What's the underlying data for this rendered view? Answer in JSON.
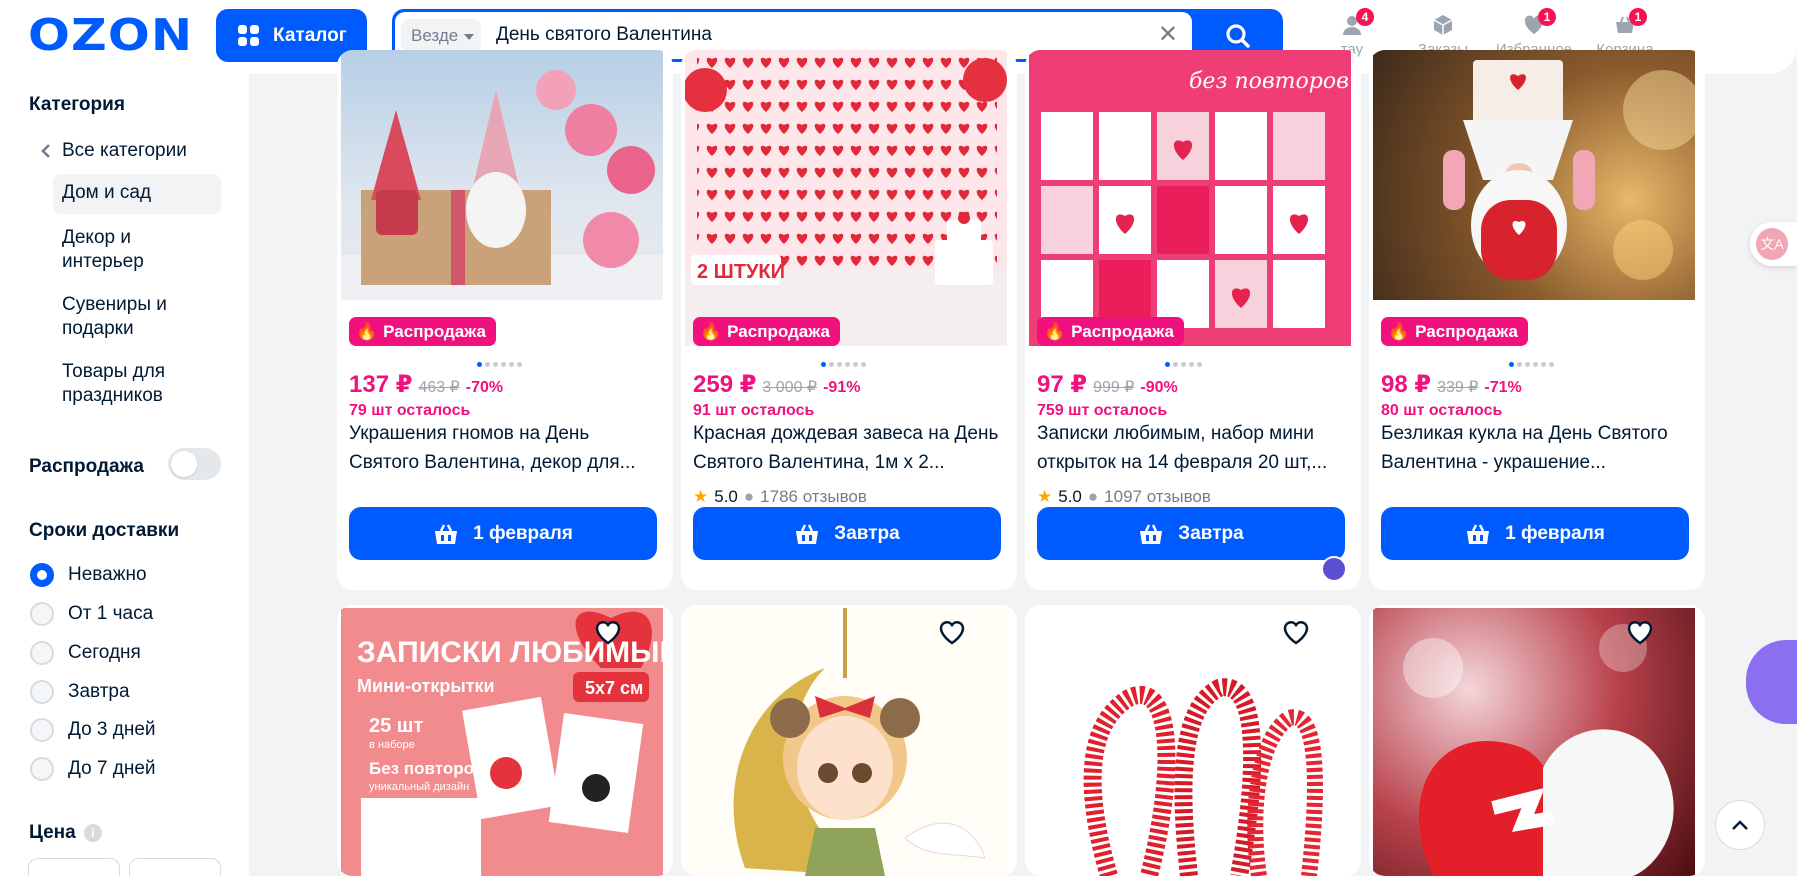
{
  "header": {
    "logo": "OZON",
    "catalog_label": "Каталог",
    "search": {
      "scope": "Везде",
      "query": "День святого Валентина"
    },
    "items": [
      {
        "label": "тау",
        "icon": "user-icon",
        "badge": "4"
      },
      {
        "label": "Заказы",
        "icon": "box-icon",
        "badge": ""
      },
      {
        "label": "Избранное",
        "icon": "heart-icon",
        "badge": "1"
      },
      {
        "label": "Корзина",
        "icon": "cart-icon",
        "badge": "1"
      }
    ]
  },
  "sidebar": {
    "category_title": "Категория",
    "all_categories": "Все категории",
    "active_category": "Дом и сад",
    "subcategories": [
      "Декор и интерьер",
      "Сувениры и подарки",
      "Товары для праздников"
    ],
    "sale_label": "Распродажа",
    "sale_on": false,
    "delivery_title": "Сроки доставки",
    "delivery_options": [
      "Неважно",
      "От 1 часа",
      "Сегодня",
      "Завтра",
      "До 3 дней",
      "До 7 дней"
    ],
    "delivery_selected": "Неважно",
    "price_title": "Цена",
    "price_info_icon": "info-icon"
  },
  "products": [
    {
      "sale_tag": "Распродажа",
      "price": "137 ₽",
      "old_price": "463 ₽",
      "discount": "-70%",
      "stock": "79 шт осталось",
      "title": "Украшения гномов на День Святого Валентина, декор для...",
      "rating": "",
      "reviews": "",
      "button": "1 февраля"
    },
    {
      "sale_tag": "Распродажа",
      "price": "259 ₽",
      "old_price": "3 000 ₽",
      "discount": "-91%",
      "stock": "91 шт осталось",
      "title": "Красная дождевая завеса на День Святого Валентина, 1м х 2...",
      "rating": "5.0",
      "reviews": "1786 отзывов",
      "button": "Завтра",
      "image_badge": "2 ШТУКИ"
    },
    {
      "sale_tag": "Распродажа",
      "price": "97 ₽",
      "old_price": "999 ₽",
      "discount": "-90%",
      "stock": "759 шт осталось",
      "title": "Записки любимым, набор мини открыток на 14 февраля 20 шт,...",
      "rating": "5.0",
      "reviews": "1097 отзывов",
      "button": "Завтра",
      "image_text": "без повторов"
    },
    {
      "sale_tag": "Распродажа",
      "price": "98 ₽",
      "old_price": "339 ₽",
      "discount": "-71%",
      "stock": "80 шт осталось",
      "title": "Безликая кукла на День Святого Валентина - украшение...",
      "rating": "",
      "reviews": "",
      "button": "1 февраля"
    }
  ],
  "second_row": {
    "card1_image": {
      "heading": "ЗАПИСКИ ЛЮБИМЫМ",
      "sub": "Мини-открытки",
      "size": "5x7 см",
      "b1": "25 шт",
      "b1s": "в наборе",
      "b2": "Без повторов",
      "b2s": "уникальный дизайн"
    }
  },
  "colors": {
    "brand": "#005bff",
    "sale": "#f1117e",
    "badge": "#f91155"
  }
}
